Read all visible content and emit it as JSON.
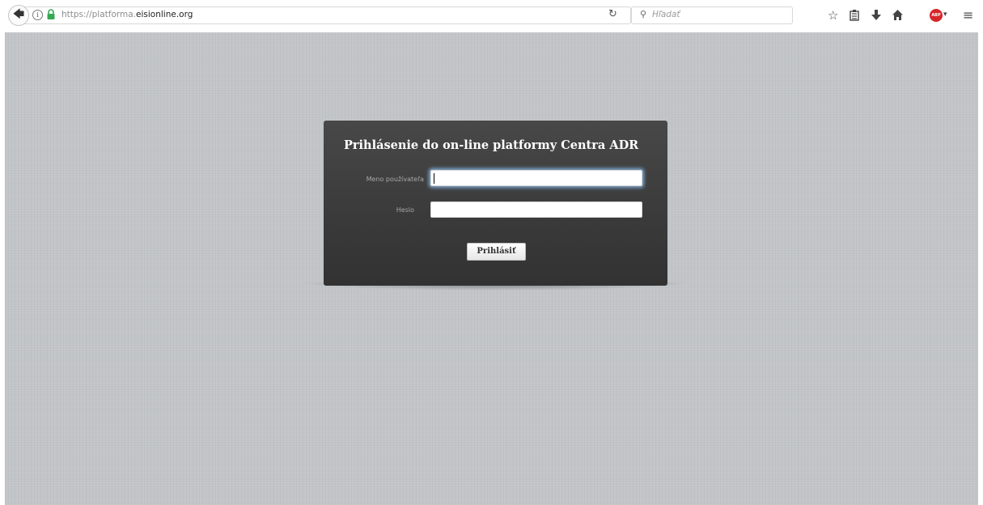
{
  "browser": {
    "url_prefix": "https://platforma.",
    "url_host": "eisionline.org",
    "search_placeholder": "Hľadať",
    "info_glyph": "i",
    "icons": [
      "back-arrow-icon",
      "info-icon",
      "lock-icon",
      "reload-icon",
      "search-icon",
      "bookmark-star-icon",
      "reading-list-icon",
      "download-icon",
      "home-icon",
      "adblock-icon",
      "menu-icon"
    ],
    "adblock_label": "ABP"
  },
  "login": {
    "title": "Prihlásenie do on-line platformy Centra ADR",
    "username_label": "Meno používateľa",
    "username_value": "",
    "password_label": "Heslo",
    "password_value": "",
    "submit_label": "Prihlásiť"
  },
  "colors": {
    "page_background": "#c2c5c8",
    "panel_background": "#3f3f3f",
    "title_text": "#ffffff",
    "label_text": "#a8a8a8",
    "lock_green": "#36a853",
    "adblock_red": "#d6262a"
  }
}
